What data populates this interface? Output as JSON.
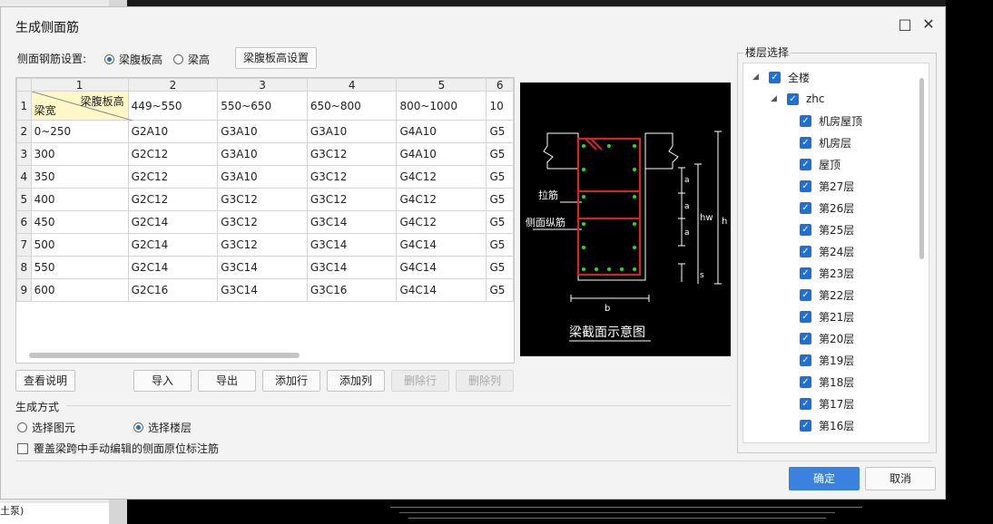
{
  "window": {
    "title": "生成侧面筋",
    "maximize_icon": "maximize-icon",
    "close_icon": "close-icon"
  },
  "background": {
    "left_bottom_text": "土泵)"
  },
  "setting": {
    "label": "侧面钢筋设置:",
    "options": [
      {
        "label": "梁腹板高",
        "selected": true
      },
      {
        "label": "梁高",
        "selected": false
      }
    ],
    "button": "梁腹板高设置"
  },
  "grid": {
    "column_numbers": [
      "1",
      "2",
      "3",
      "4",
      "5",
      "6"
    ],
    "corner_top": "梁腹板高",
    "corner_bottom": "梁宽",
    "header_values": [
      "449~550",
      "550~650",
      "650~800",
      "800~1000",
      "10"
    ],
    "rows": [
      {
        "num": "2",
        "width": "0~250",
        "cells": [
          "G2A10",
          "G3A10",
          "G3A10",
          "G4A10",
          "G5"
        ]
      },
      {
        "num": "3",
        "width": "300",
        "cells": [
          "G2C12",
          "G3A10",
          "G3C12",
          "G4A10",
          "G5"
        ]
      },
      {
        "num": "4",
        "width": "350",
        "cells": [
          "G2C12",
          "G3A10",
          "G3C12",
          "G4C12",
          "G5"
        ]
      },
      {
        "num": "5",
        "width": "400",
        "cells": [
          "G2C12",
          "G3C12",
          "G3C12",
          "G4C12",
          "G5"
        ]
      },
      {
        "num": "6",
        "width": "450",
        "cells": [
          "G2C14",
          "G3C12",
          "G3C14",
          "G4C12",
          "G5"
        ]
      },
      {
        "num": "7",
        "width": "500",
        "cells": [
          "G2C14",
          "G3C12",
          "G3C14",
          "G4C14",
          "G5"
        ]
      },
      {
        "num": "8",
        "width": "550",
        "cells": [
          "G2C14",
          "G3C14",
          "G3C14",
          "G4C14",
          "G5"
        ]
      },
      {
        "num": "9",
        "width": "600",
        "cells": [
          "G2C16",
          "G3C14",
          "G3C16",
          "G4C14",
          "G5"
        ]
      }
    ],
    "first_row_num": "1"
  },
  "buttons": {
    "view_help": "查看说明",
    "import": "导入",
    "export": "导出",
    "add_row": "添加行",
    "add_col": "添加列",
    "delete_row": "删除行",
    "delete_col": "删除列",
    "ok": "确定",
    "cancel": "取消"
  },
  "diagram": {
    "caption": "梁截面示意图",
    "label_tie": "拉筋",
    "label_side": "侧面纵筋",
    "label_a1": "a",
    "label_a2": "a",
    "label_a3": "a",
    "label_hw": "hw",
    "label_h": "h",
    "label_s": "s",
    "label_b": "b"
  },
  "generate": {
    "section": "生成方式",
    "options": [
      {
        "label": "选择图元",
        "selected": false
      },
      {
        "label": "选择楼层",
        "selected": true
      }
    ],
    "override_label": "覆盖梁跨中手动编辑的侧面原位标注筋"
  },
  "floors": {
    "group_title": "楼层选择",
    "root": "全楼",
    "project": "zhc",
    "items": [
      "机房屋顶",
      "机房层",
      "屋顶",
      "第27层",
      "第26层",
      "第25层",
      "第24层",
      "第23层",
      "第22层",
      "第21层",
      "第20层",
      "第19层",
      "第18层",
      "第17层",
      "第16层"
    ]
  },
  "colors": {
    "accent": "#1e6fd9",
    "primary_button": "#3b82e0",
    "diagram_red": "#e02020",
    "diagram_green": "#20e020"
  }
}
